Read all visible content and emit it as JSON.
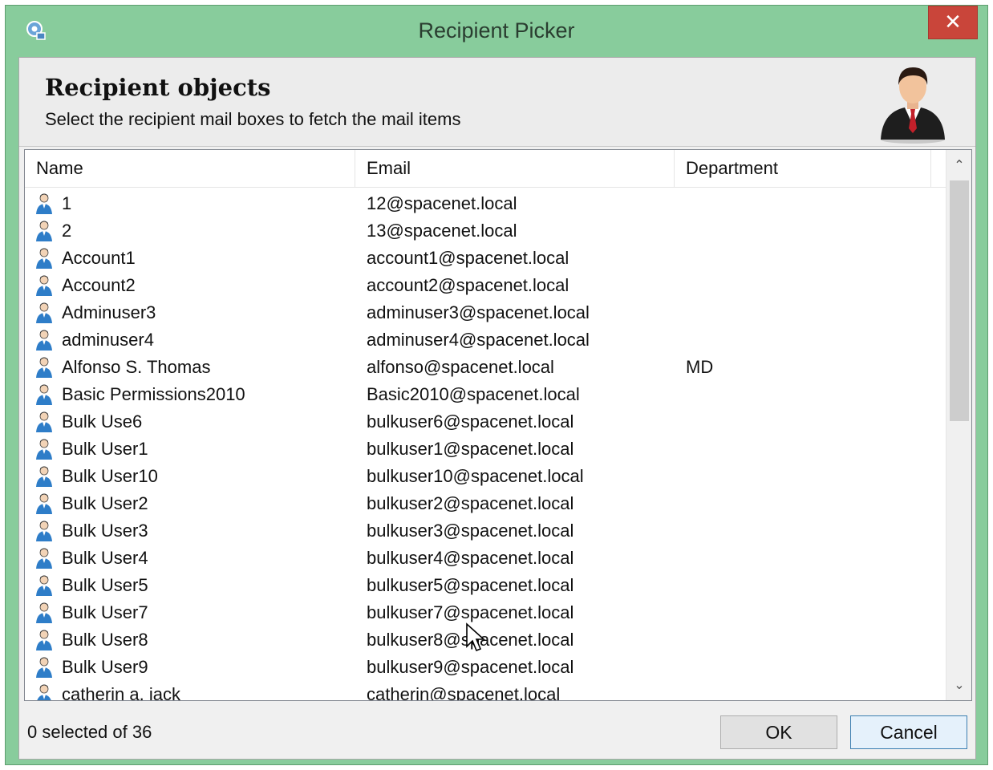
{
  "window": {
    "title": "Recipient Picker",
    "close_symbol": "✕"
  },
  "header": {
    "title": "Recipient objects",
    "subtitle": "Select the recipient mail boxes to fetch the mail items",
    "icon": "businessman-icon"
  },
  "list": {
    "columns": [
      "Name",
      "Email",
      "Department"
    ],
    "rows": [
      {
        "name": "1",
        "email": "12@spacenet.local",
        "department": ""
      },
      {
        "name": "2",
        "email": "13@spacenet.local",
        "department": ""
      },
      {
        "name": "Account1",
        "email": "account1@spacenet.local",
        "department": ""
      },
      {
        "name": "Account2",
        "email": "account2@spacenet.local",
        "department": ""
      },
      {
        "name": "Adminuser3",
        "email": "adminuser3@spacenet.local",
        "department": ""
      },
      {
        "name": "adminuser4",
        "email": "adminuser4@spacenet.local",
        "department": ""
      },
      {
        "name": "Alfonso S. Thomas",
        "email": "alfonso@spacenet.local",
        "department": "MD"
      },
      {
        "name": "Basic Permissions2010",
        "email": "Basic2010@spacenet.local",
        "department": ""
      },
      {
        "name": "Bulk Use6",
        "email": "bulkuser6@spacenet.local",
        "department": ""
      },
      {
        "name": "Bulk User1",
        "email": "bulkuser1@spacenet.local",
        "department": ""
      },
      {
        "name": "Bulk User10",
        "email": "bulkuser10@spacenet.local",
        "department": ""
      },
      {
        "name": "Bulk User2",
        "email": "bulkuser2@spacenet.local",
        "department": ""
      },
      {
        "name": "Bulk User3",
        "email": "bulkuser3@spacenet.local",
        "department": ""
      },
      {
        "name": "Bulk User4",
        "email": "bulkuser4@spacenet.local",
        "department": ""
      },
      {
        "name": "Bulk User5",
        "email": "bulkuser5@spacenet.local",
        "department": ""
      },
      {
        "name": "Bulk User7",
        "email": "bulkuser7@spacenet.local",
        "department": ""
      },
      {
        "name": "Bulk User8",
        "email": "bulkuser8@spacenet.local",
        "department": ""
      },
      {
        "name": "Bulk User9",
        "email": "bulkuser9@spacenet.local",
        "department": ""
      },
      {
        "name": "catherin a. jack",
        "email": "catherin@spacenet.local",
        "department": ""
      }
    ]
  },
  "footer": {
    "status": "0 selected of 36",
    "ok_label": "OK",
    "cancel_label": "Cancel"
  },
  "colors": {
    "frame": "#88cc9c",
    "close_button": "#c9453a",
    "default_button_border": "#3c7fb1"
  }
}
